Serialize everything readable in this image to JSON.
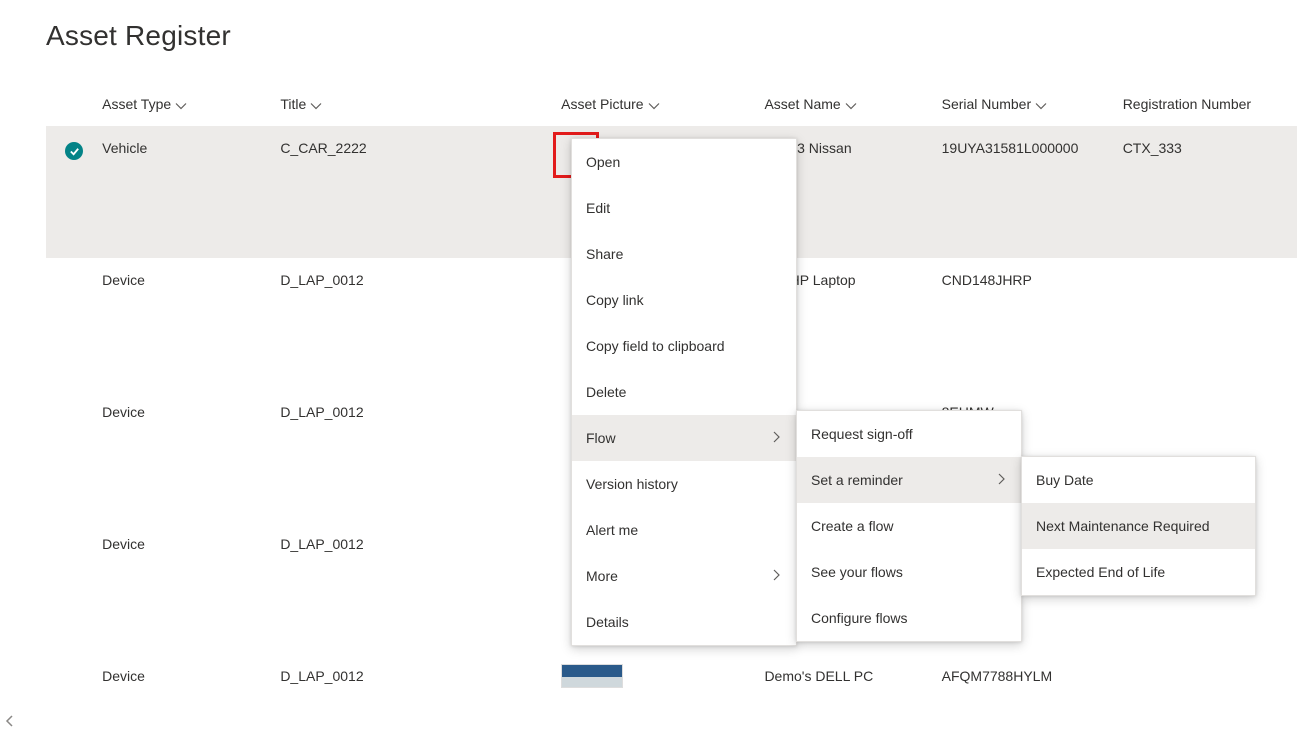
{
  "page_title": "Asset Register",
  "columns": {
    "type": "Asset Type",
    "title": "Title",
    "pic": "Asset Picture",
    "name": "Asset Name",
    "serial": "Serial Number",
    "reg": "Registration Number"
  },
  "rows": [
    {
      "selected": true,
      "type": "Vehicle",
      "title": "C_CAR_2222",
      "name": "X_333 Nissan",
      "serial": "19UYA31581L000000",
      "reg": "CTX_333"
    },
    {
      "selected": false,
      "type": "Device",
      "title": "D_LAP_0012",
      "name": "m's HP Laptop",
      "serial": "CND148JHRP",
      "reg": ""
    },
    {
      "selected": false,
      "type": "Device",
      "title": "D_LAP_0012",
      "name": "",
      "serial": "8EHMW",
      "reg": ""
    },
    {
      "selected": false,
      "type": "Device",
      "title": "D_LAP_0012",
      "name": "",
      "serial": "",
      "reg": ""
    },
    {
      "selected": false,
      "type": "Device",
      "title": "D_LAP_0012",
      "name": "Demo's DELL PC",
      "serial": "AFQM7788HYLM",
      "reg": ""
    }
  ],
  "context_menu": {
    "open": "Open",
    "edit": "Edit",
    "share": "Share",
    "copy_link": "Copy link",
    "copy_field": "Copy field to clipboard",
    "delete": "Delete",
    "flow": "Flow",
    "version": "Version history",
    "alert": "Alert me",
    "more": "More",
    "details": "Details"
  },
  "flow_menu": {
    "request": "Request sign-off",
    "reminder": "Set a reminder",
    "create": "Create a flow",
    "see": "See your flows",
    "configure": "Configure flows"
  },
  "reminder_menu": {
    "buy": "Buy Date",
    "maint": "Next Maintenance Required",
    "eol": "Expected End of Life"
  }
}
